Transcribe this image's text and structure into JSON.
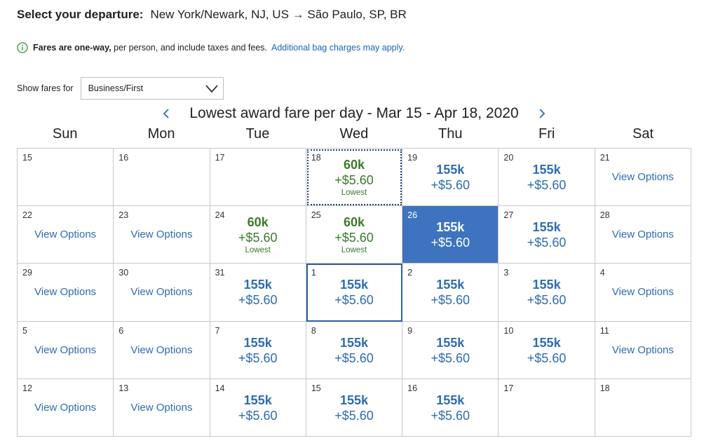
{
  "header": {
    "label": "Select your departure:",
    "route": "New York/Newark, NJ, US → São Paulo, SP, BR"
  },
  "notice": {
    "bold": "Fares are one-way,",
    "text": " per person, and include taxes and fees.",
    "link": "Additional bag charges may apply."
  },
  "filter": {
    "label": "Show fares for",
    "selected": "Business/First"
  },
  "calendar": {
    "title": "Lowest award fare per day - Mar 15 - Apr 18, 2020",
    "days_of_week": [
      "Sun",
      "Mon",
      "Tue",
      "Wed",
      "Thu",
      "Fri",
      "Sat"
    ],
    "view_options_label": "View Options",
    "weeks": [
      [
        {
          "day": "15",
          "kind": "empty"
        },
        {
          "day": "16",
          "kind": "empty"
        },
        {
          "day": "17",
          "kind": "empty"
        },
        {
          "day": "18",
          "kind": "fare",
          "miles": "60k",
          "tax": "+$5.60",
          "note": "Lowest",
          "state": "outlined"
        },
        {
          "day": "19",
          "kind": "fare",
          "miles": "155k",
          "tax": "+$5.60"
        },
        {
          "day": "20",
          "kind": "fare",
          "miles": "155k",
          "tax": "+$5.60"
        },
        {
          "day": "21",
          "kind": "options"
        }
      ],
      [
        {
          "day": "22",
          "kind": "options"
        },
        {
          "day": "23",
          "kind": "options"
        },
        {
          "day": "24",
          "kind": "fare",
          "miles": "60k",
          "tax": "+$5.60",
          "note": "Lowest"
        },
        {
          "day": "25",
          "kind": "fare",
          "miles": "60k",
          "tax": "+$5.60",
          "note": "Lowest"
        },
        {
          "day": "26",
          "kind": "fare",
          "miles": "155k",
          "tax": "+$5.60",
          "state": "selected"
        },
        {
          "day": "27",
          "kind": "fare",
          "miles": "155k",
          "tax": "+$5.60"
        },
        {
          "day": "28",
          "kind": "options"
        }
      ],
      [
        {
          "day": "29",
          "kind": "options"
        },
        {
          "day": "30",
          "kind": "options"
        },
        {
          "day": "31",
          "kind": "fare",
          "miles": "155k",
          "tax": "+$5.60"
        },
        {
          "day": "1",
          "kind": "fare",
          "miles": "155k",
          "tax": "+$5.60",
          "state": "boxed"
        },
        {
          "day": "2",
          "kind": "fare",
          "miles": "155k",
          "tax": "+$5.60"
        },
        {
          "day": "3",
          "kind": "fare",
          "miles": "155k",
          "tax": "+$5.60"
        },
        {
          "day": "4",
          "kind": "options"
        }
      ],
      [
        {
          "day": "5",
          "kind": "options"
        },
        {
          "day": "6",
          "kind": "options"
        },
        {
          "day": "7",
          "kind": "fare",
          "miles": "155k",
          "tax": "+$5.60"
        },
        {
          "day": "8",
          "kind": "fare",
          "miles": "155k",
          "tax": "+$5.60"
        },
        {
          "day": "9",
          "kind": "fare",
          "miles": "155k",
          "tax": "+$5.60"
        },
        {
          "day": "10",
          "kind": "fare",
          "miles": "155k",
          "tax": "+$5.60"
        },
        {
          "day": "11",
          "kind": "options"
        }
      ],
      [
        {
          "day": "12",
          "kind": "options"
        },
        {
          "day": "13",
          "kind": "options"
        },
        {
          "day": "14",
          "kind": "fare",
          "miles": "155k",
          "tax": "+$5.60"
        },
        {
          "day": "15",
          "kind": "fare",
          "miles": "155k",
          "tax": "+$5.60"
        },
        {
          "day": "16",
          "kind": "fare",
          "miles": "155k",
          "tax": "+$5.60"
        },
        {
          "day": "17",
          "kind": "empty"
        },
        {
          "day": "18",
          "kind": "empty"
        }
      ]
    ]
  },
  "icons": {
    "info": "info-icon",
    "dropdown": "chevron-down-icon",
    "prev": "chevron-left-icon",
    "next": "chevron-right-icon"
  },
  "colors": {
    "link_blue": "#2d6cb3",
    "lowest_green": "#3b7a2c",
    "selected_bg": "#3e74bf",
    "info_green": "#3a8a3a"
  }
}
